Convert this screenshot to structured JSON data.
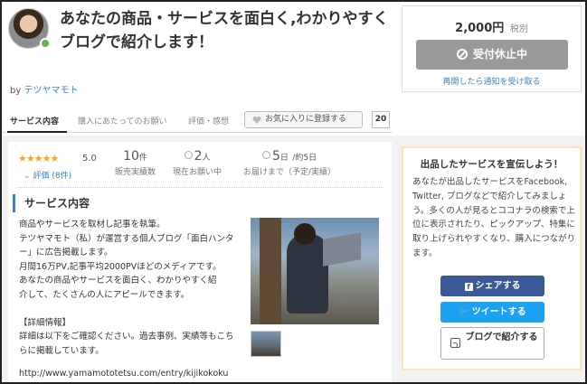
{
  "service": {
    "title": "あなたの商品・サービスを面白く,わかりやすくブログで紹介します！",
    "by_label": "by",
    "seller": "テツヤマモト"
  },
  "purchase": {
    "price": "2,000",
    "currency": "円",
    "tax_note": "税別",
    "suspend_label": "受付休止中",
    "notify_link": "再開したら通知を受け取る"
  },
  "tabs": [
    {
      "label": "サービス内容"
    },
    {
      "label": "購入にあたってのお願い"
    },
    {
      "label": "評価・感想"
    }
  ],
  "favorite": {
    "label": "お気に入りに登録する",
    "count": "20"
  },
  "stats": {
    "stars": "★★★★★",
    "rating": "5.0",
    "review_link": "評価 (8件)",
    "sales_num": "10",
    "sales_unit": "件",
    "sales_label": "販売実績数",
    "requests_num": "2",
    "requests_unit": "人",
    "requests_label": "現在お願い中",
    "delivery_num": "5",
    "delivery_unit": "日",
    "delivery_approx": "/約5日",
    "delivery_label": "お届けまで（予定/実績）"
  },
  "content": {
    "section_title": "サービス内容",
    "lines": [
      "商品やサービスを取材し記事を執筆。",
      "テツヤマモト（私）が運営する個人ブログ「面白ハンタ",
      "ー」に広告掲載します。",
      "月間16万PV,記事平均2000PVほどのメディアです。",
      "あなたの商品やサービスを面白く、わかりやすく紹",
      "介して、たくさんの人にアピールできます。"
    ],
    "details_heading": "【詳細情報】",
    "details_lines": [
      "詳細は以下をご確認ください。過去事例、実績等もこち",
      "らに掲載しています。"
    ],
    "url": "http://www.yamamototetsu.com/entry/kijikokoku"
  },
  "promo": {
    "title": "出品したサービスを宣伝しよう！",
    "text": "あなたが出品したサービスをFacebook, Twitter, ブログなどで紹介してみましょう。多くの人が見るとココナラの検索で上位に表示されたり、ピックアップ、特集に取り上げられやすくなり、購入につながります。",
    "share_label": "シェアする",
    "tweet_label": "ツイートする",
    "blog_label": "ブログで紹介する"
  }
}
